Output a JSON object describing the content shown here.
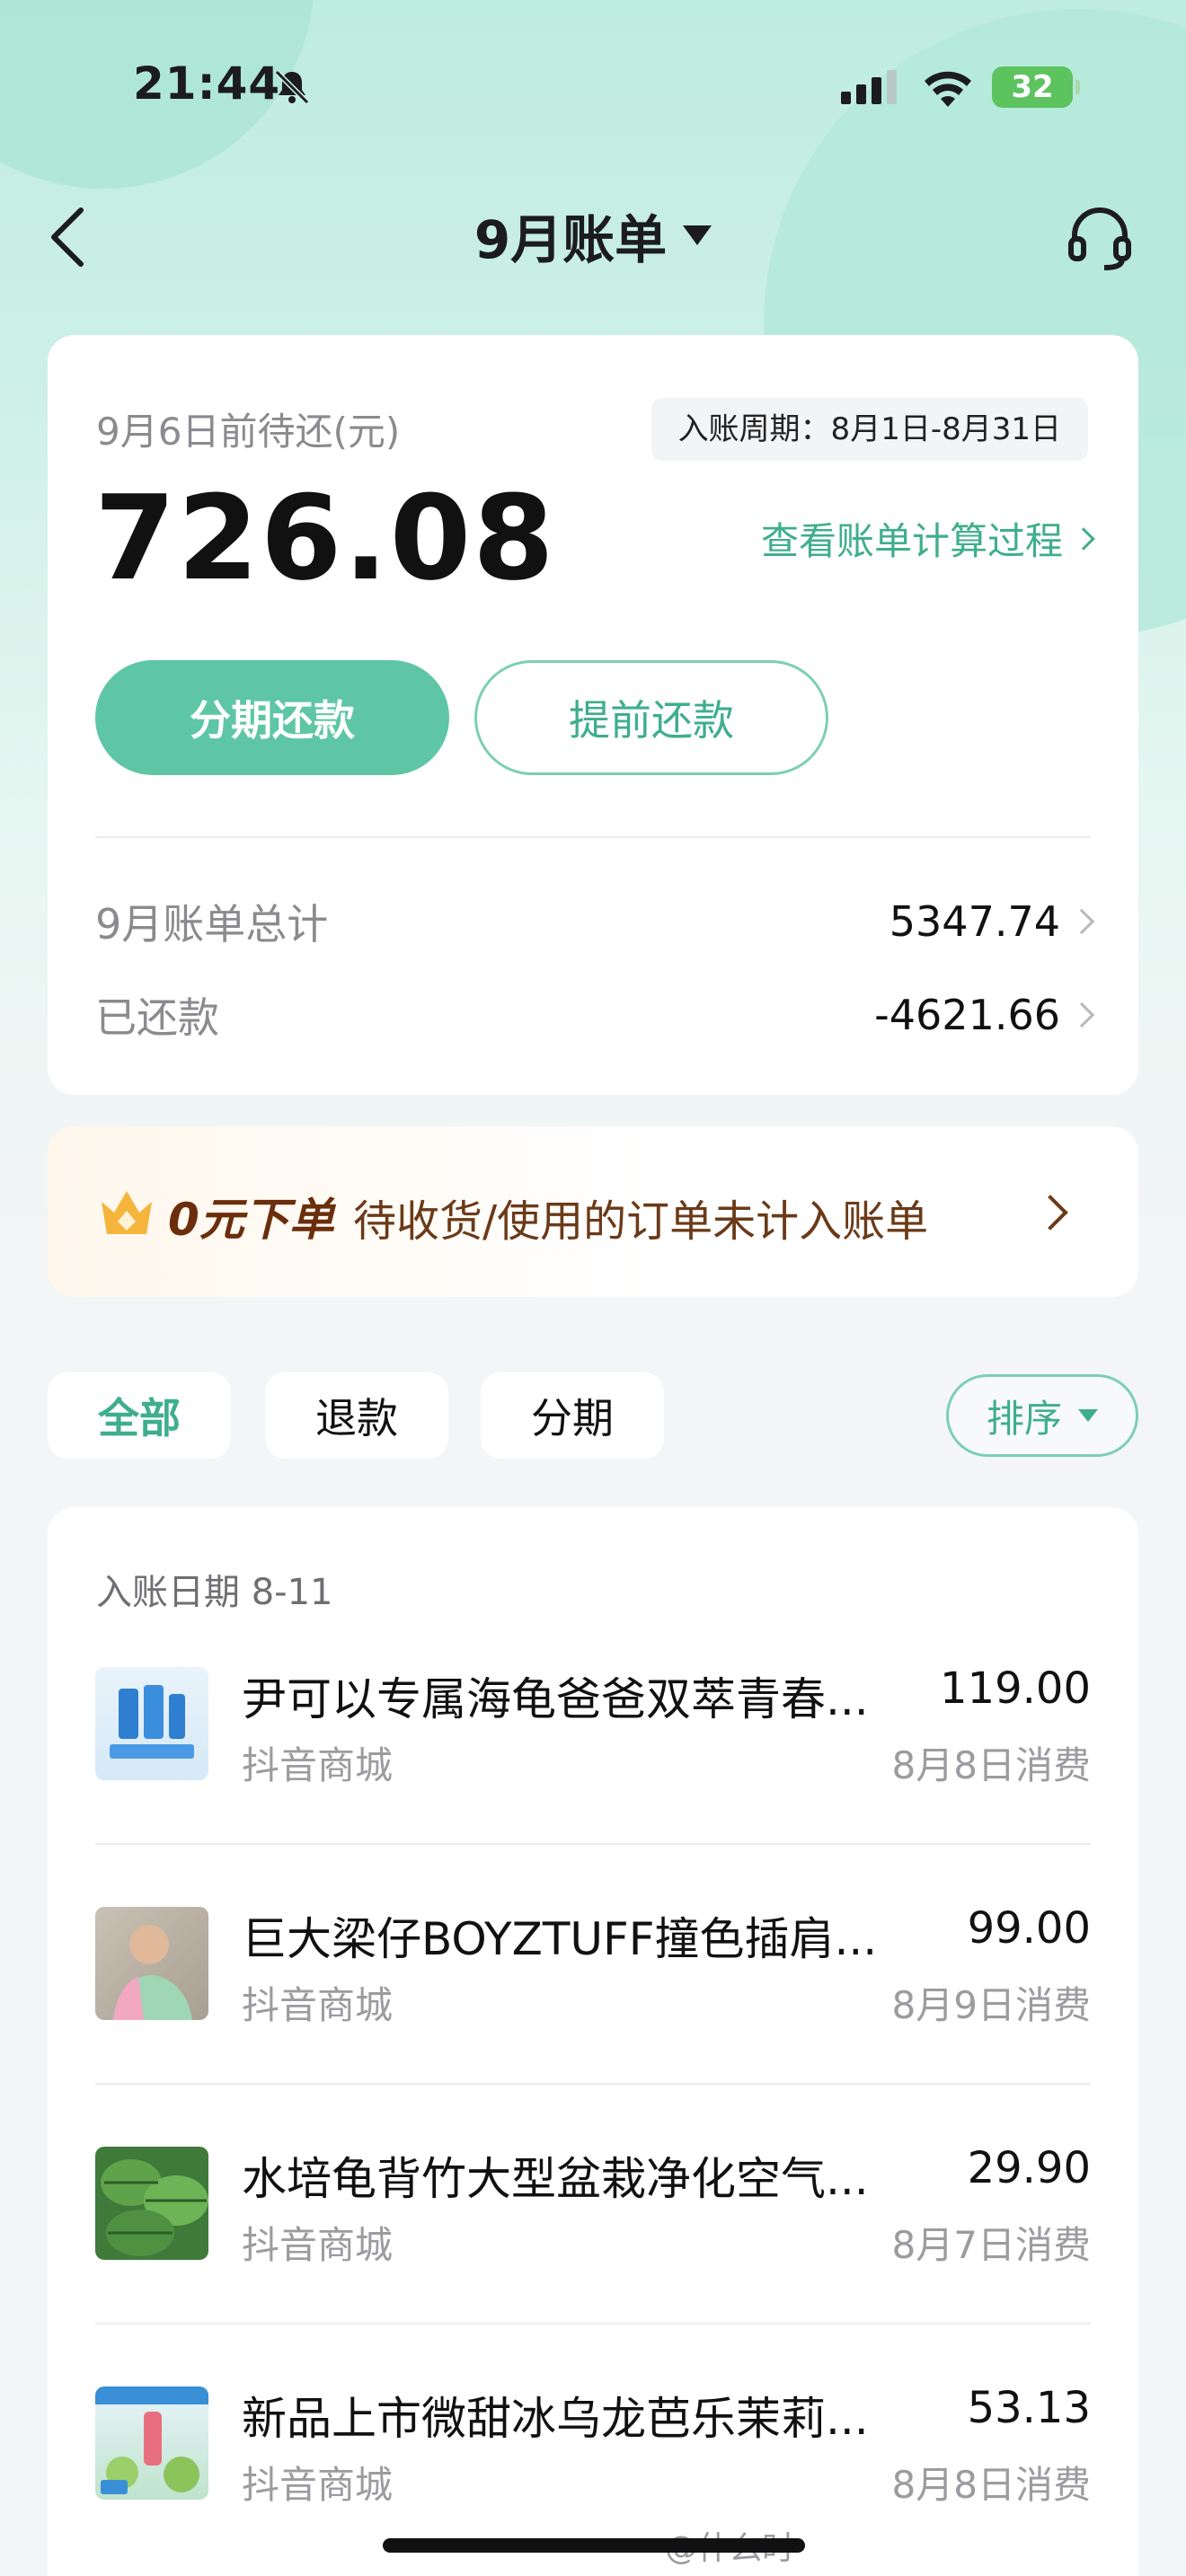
{
  "status_bar": {
    "time": "21:44",
    "battery": "32"
  },
  "nav": {
    "title": "9月账单"
  },
  "bill": {
    "due_label": "9月6日前待还(元)",
    "period": "入账周期：8月1日-8月31日",
    "amount": "726.08",
    "calc_link": "查看账单计算过程",
    "installment_button": "分期还款",
    "early_repay_button": "提前还款",
    "total_label": "9月账单总计",
    "total_value": "5347.74",
    "repaid_label": "已还款",
    "repaid_value": "-4621.66"
  },
  "promo": {
    "title": "0元下单",
    "text": "待收货/使用的订单未计入账单"
  },
  "filters": {
    "tabs": [
      "全部",
      "退款",
      "分期"
    ],
    "active": "全部",
    "sort": "排序"
  },
  "list": {
    "date_header": "入账日期 8-11",
    "items": [
      {
        "name": "尹可以专属海龟爸爸双萃青春...",
        "price": "119.00",
        "shop": "抖音商城",
        "date": "8月8日消费"
      },
      {
        "name": "巨大梁仔BOYZTUFF撞色插肩...",
        "price": "99.00",
        "shop": "抖音商城",
        "date": "8月9日消费"
      },
      {
        "name": "水培龟背竹大型盆栽净化空气...",
        "price": "29.90",
        "shop": "抖音商城",
        "date": "8月7日消费"
      },
      {
        "name": "新品上市微甜冰乌龙芭乐茉莉...",
        "price": "53.13",
        "shop": "抖音商城",
        "date": "8月8日消费"
      }
    ]
  },
  "watermark": "@什么时",
  "colors": {
    "accent": "#5ec6a4",
    "accent_text": "#3fae8c",
    "promo_text": "#6b2e0c"
  }
}
